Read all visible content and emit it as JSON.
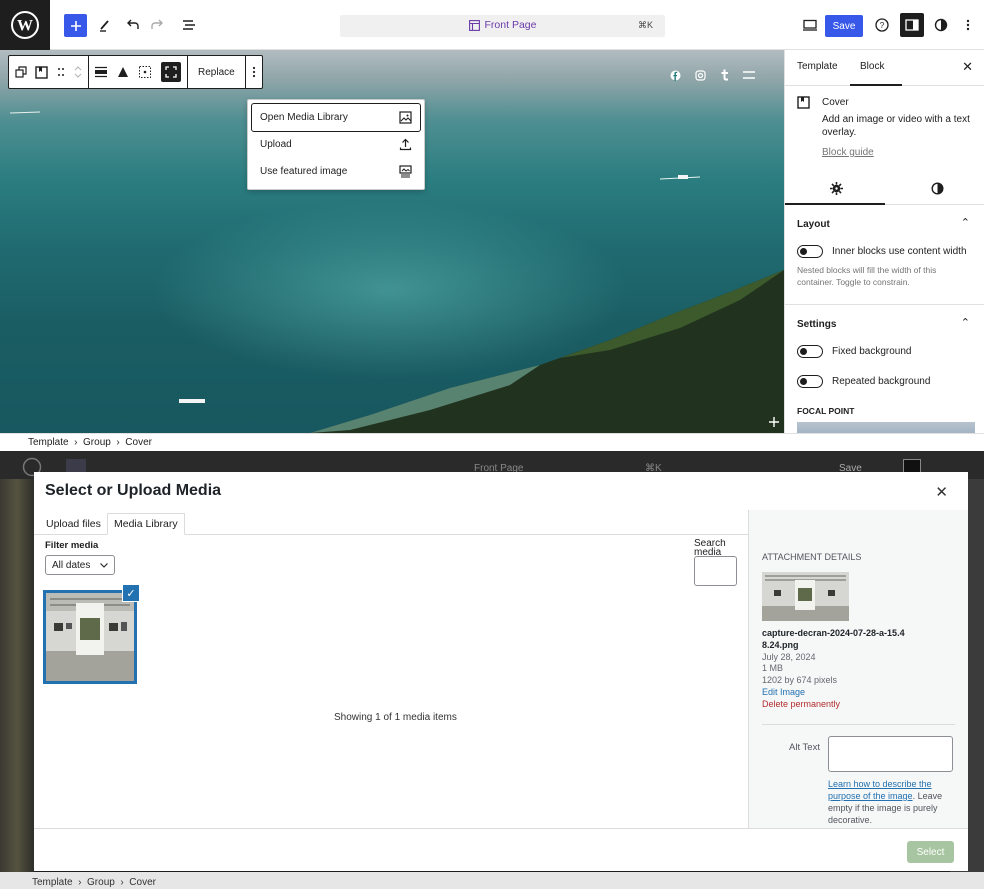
{
  "editor": {
    "command_bar": {
      "title": "Front Page",
      "shortcut": "⌘K"
    },
    "save_label": "Save",
    "block_toolbar": {
      "replace_label": "Replace"
    },
    "media_popover": [
      {
        "label": "Open Media Library",
        "icon": "media-library-icon"
      },
      {
        "label": "Upload",
        "icon": "upload-icon"
      },
      {
        "label": "Use featured image",
        "icon": "featured-image-icon"
      }
    ],
    "breadcrumb": [
      "Template",
      "Group",
      "Cover"
    ]
  },
  "sidebar": {
    "tabs": [
      "Template",
      "Block"
    ],
    "active_tab": "Block",
    "block": {
      "name": "Cover",
      "description": "Add an image or video with a text overlay.",
      "guide_link": "Block guide"
    },
    "layout": {
      "title": "Layout",
      "toggle_label": "Inner blocks use content width",
      "help": "Nested blocks will fill the width of this container. Toggle to constrain."
    },
    "settings": {
      "title": "Settings",
      "fixed_bg": "Fixed background",
      "repeated_bg": "Repeated background",
      "focal_point": "FOCAL POINT"
    }
  },
  "modal": {
    "title": "Select or Upload Media",
    "tabs": [
      "Upload files",
      "Media Library"
    ],
    "active_tab": "Media Library",
    "filter_label": "Filter media",
    "date_filter": "All dates",
    "search_label": "Search media",
    "showing": "Showing 1 of 1 media items",
    "details": {
      "heading": "ATTACHMENT DETAILS",
      "filename": "capture-decran-2024-07-28-a-15.48.24.png",
      "date": "July 28, 2024",
      "size": "1 MB",
      "dimensions": "1202 by 674 pixels",
      "edit_link": "Edit Image",
      "delete_link": "Delete permanently",
      "alt_label": "Alt Text",
      "alt_help_link": "Learn how to describe the purpose of the image",
      "alt_help_text": ". Leave empty if the image is purely decorative."
    },
    "select_label": "Select"
  },
  "background": {
    "command_title": "Front Page",
    "shortcut": "⌘K",
    "save_label": "Save",
    "breadcrumb": [
      "Template",
      "Group",
      "Cover"
    ]
  },
  "colors": {
    "wp_blue": "#3858e9",
    "admin_blue": "#2271b1",
    "delete_red": "#b32d2e",
    "purple": "#6b3aa8"
  }
}
